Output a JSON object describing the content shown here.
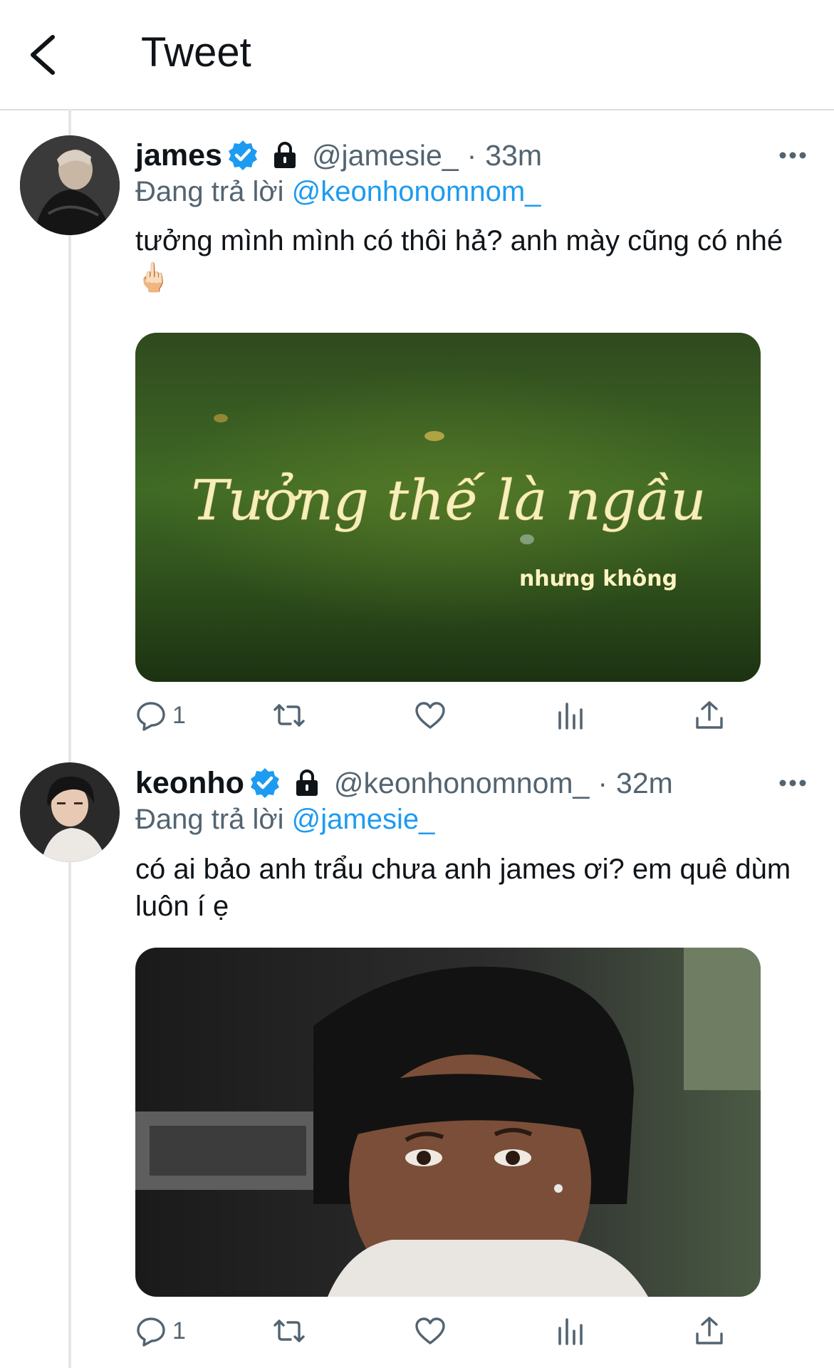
{
  "header": {
    "title": "Tweet",
    "back_icon": "chevron-left-icon"
  },
  "colors": {
    "link": "#1d9bf0",
    "secondary": "#536471",
    "text": "#0f1419",
    "verified": "#1d9bf0"
  },
  "tweets": [
    {
      "name": "james",
      "handle": "@jamesie_",
      "separator": "·",
      "time": "33m",
      "replying_prefix": "Đang trả lời",
      "replying_to": "@keonhonomnom_",
      "text": "tưởng mình mình có thôi hả? anh mày cũng có nhé 🖕🏻",
      "media": {
        "caption_script": "Tưởng thế là ngầu",
        "caption_sub": "nhưng không"
      },
      "reply_count": "1"
    },
    {
      "name": "keonho",
      "handle": "@keonhonomnom_",
      "separator": "·",
      "time": "32m",
      "replying_prefix": "Đang trả lời",
      "replying_to": "@jamesie_",
      "text": "có ai bảo anh trẩu chưa anh james ơi? em quê dùm luôn í ẹ",
      "media": {},
      "reply_count": "1"
    }
  ]
}
